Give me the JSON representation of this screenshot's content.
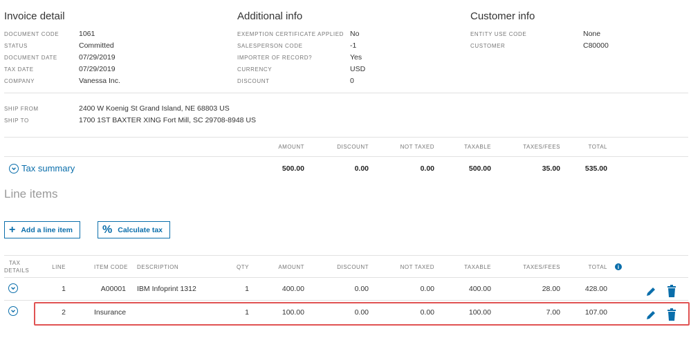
{
  "invoice": {
    "title": "Invoice detail",
    "fields": [
      {
        "label": "DOCUMENT CODE",
        "value": "1061"
      },
      {
        "label": "STATUS",
        "value": "Committed"
      },
      {
        "label": "DOCUMENT DATE",
        "value": "07/29/2019"
      },
      {
        "label": "TAX DATE",
        "value": "07/29/2019"
      },
      {
        "label": "COMPANY",
        "value": "Vanessa Inc."
      }
    ]
  },
  "additional": {
    "title": "Additional info",
    "fields": [
      {
        "label": "EXEMPTION CERTIFICATE APPLIED",
        "value": "No"
      },
      {
        "label": "SALESPERSON CODE",
        "value": "-1"
      },
      {
        "label": "IMPORTER OF RECORD?",
        "value": "Yes"
      },
      {
        "label": "CURRENCY",
        "value": "USD"
      },
      {
        "label": "DISCOUNT",
        "value": "0"
      }
    ]
  },
  "customer": {
    "title": "Customer info",
    "fields": [
      {
        "label": "ENTITY USE CODE",
        "value": "None"
      },
      {
        "label": "CUSTOMER",
        "value": "C80000"
      }
    ]
  },
  "shipping": {
    "from_label": "SHIP FROM",
    "from_value": "2400 W Koenig St Grand Island, NE 68803 US",
    "to_label": "SHIP TO",
    "to_value": "1700 1ST BAXTER XING Fort Mill, SC 29708-8948 US"
  },
  "summary": {
    "headers": [
      "AMOUNT",
      "DISCOUNT",
      "NOT TAXED",
      "TAXABLE",
      "TAXES/FEES",
      "TOTAL"
    ],
    "toggle_label": "Tax summary",
    "values": [
      "500.00",
      "0.00",
      "0.00",
      "500.00",
      "35.00",
      "535.00"
    ]
  },
  "line_items": {
    "title": "Line items",
    "add_button": "Add a line item",
    "calc_button": "Calculate tax",
    "headers": {
      "tax_details_1": "TAX",
      "tax_details_2": "DETAILS",
      "line": "LINE",
      "item_code": "ITEM CODE",
      "description": "DESCRIPTION",
      "qty": "QTY",
      "amount": "AMOUNT",
      "discount": "DISCOUNT",
      "not_taxed": "NOT TAXED",
      "taxable": "TAXABLE",
      "taxes_fees": "TAXES/FEES",
      "total": "TOTAL"
    },
    "rows": [
      {
        "line": "1",
        "item_code": "A00001",
        "description": "IBM Infoprint 1312",
        "qty": "1",
        "amount": "400.00",
        "discount": "0.00",
        "not_taxed": "0.00",
        "taxable": "400.00",
        "taxes_fees": "28.00",
        "total": "428.00"
      },
      {
        "line": "2",
        "item_code": "Insurance",
        "description": "",
        "qty": "1",
        "amount": "100.00",
        "discount": "0.00",
        "not_taxed": "0.00",
        "taxable": "100.00",
        "taxes_fees": "7.00",
        "total": "107.00"
      }
    ]
  },
  "colors": {
    "accent": "#0a6eab",
    "highlight": "#e05252"
  }
}
